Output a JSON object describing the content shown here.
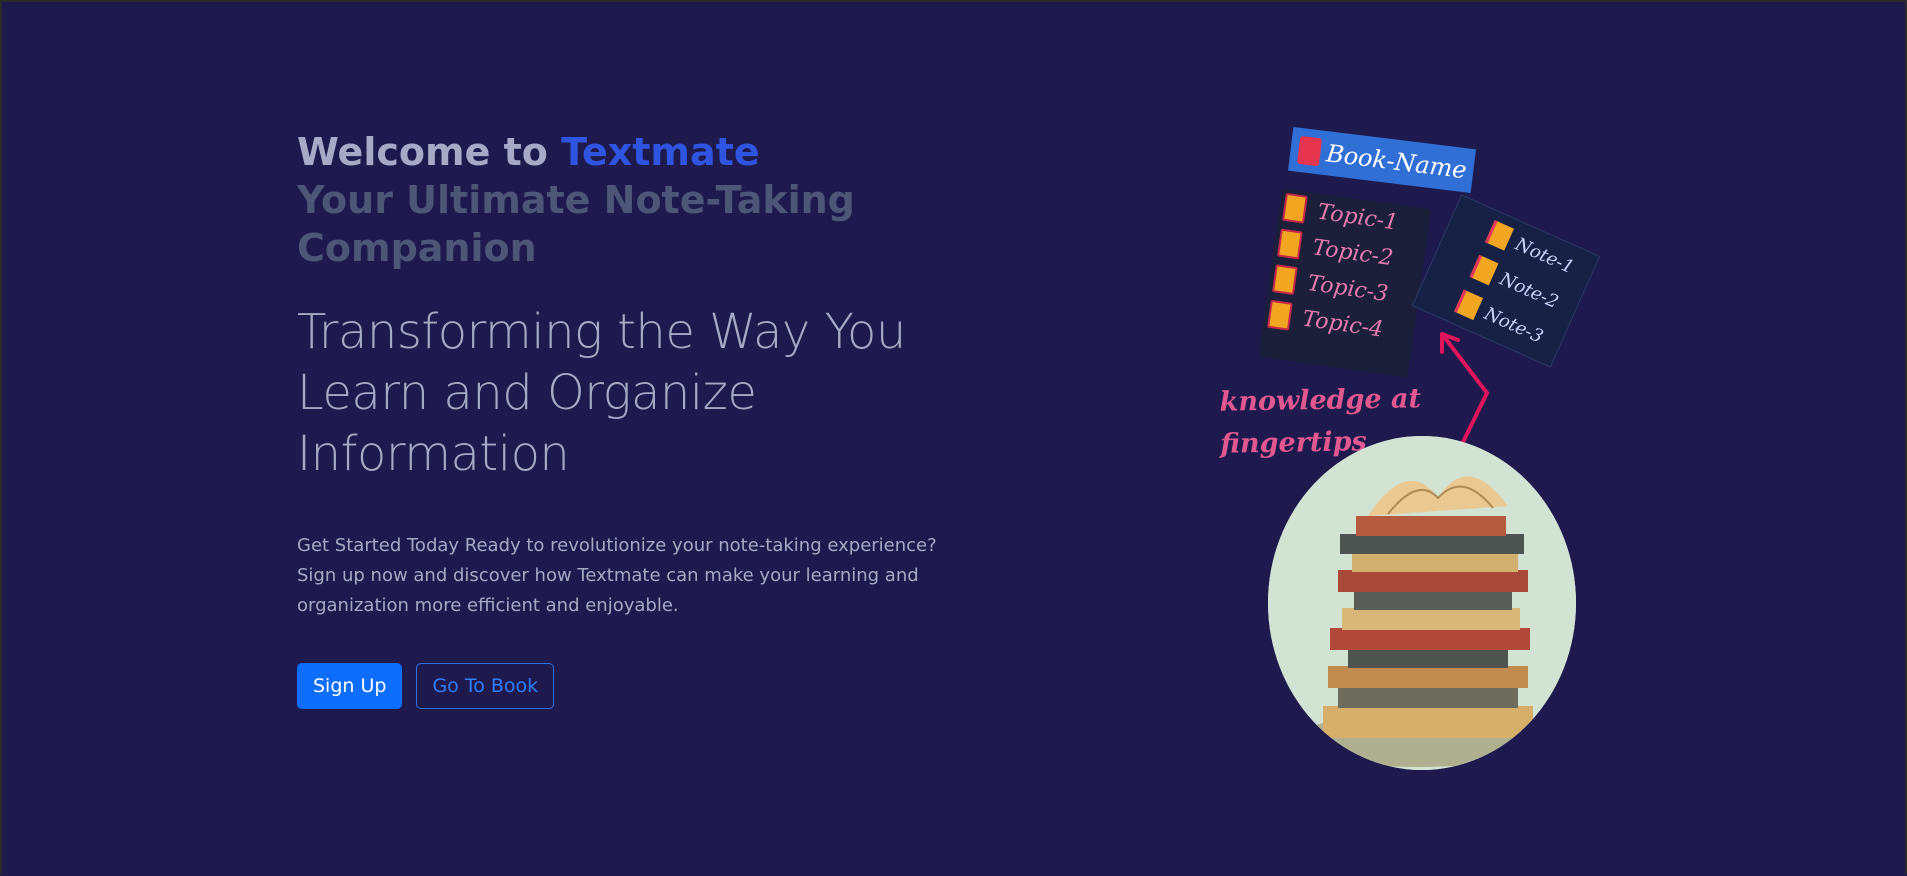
{
  "hero": {
    "welcome_prefix": "Welcome to ",
    "brand_name": "Textmate",
    "subtitle": "Your Ultimate Note-Taking Companion",
    "lead": "Transforming the Way You Learn and Organize Information",
    "description": "Get Started Today Ready to revolutionize your note-taking experience? Sign up now and discover how Textmate can make your learning and organization more efficient and enjoyable.",
    "buttons": {
      "primary_label": "Sign Up",
      "secondary_label": "Go To Book"
    }
  },
  "illustration": {
    "book_name_label": "Book-Name",
    "topics": [
      "Topic-1",
      "Topic-2",
      "Topic-3",
      "Topic-4"
    ],
    "notes": [
      "Note-1",
      "Note-2",
      "Note-3"
    ],
    "tagline_line1": "knowledge at",
    "tagline_line2": "fingertips"
  },
  "colors": {
    "background": "#1f1a4d",
    "brand": "#2f55e0",
    "primary_button": "#0d6efd",
    "tagline": "#e0588f",
    "arrow": "#e0145a"
  }
}
